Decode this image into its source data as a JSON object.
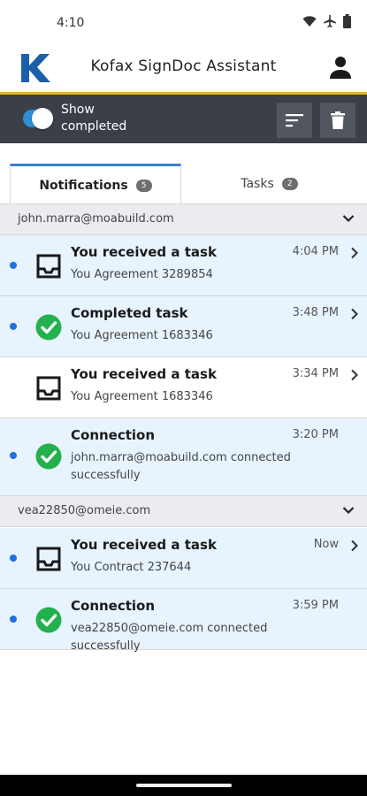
{
  "status_bar": {
    "time": "4:10"
  },
  "header": {
    "title": "Kofax SignDoc Assistant",
    "logo_letter": "K"
  },
  "toolbar": {
    "toggle_label": "Show completed",
    "toggle_on": true
  },
  "tabs": [
    {
      "label": "Notifications",
      "count": "5",
      "active": true
    },
    {
      "label": "Tasks",
      "count": "2",
      "active": false
    }
  ],
  "groups": [
    {
      "email": "john.marra@moabuild.com",
      "items": [
        {
          "title": "You received a task",
          "subtitle": "You Agreement 3289854",
          "time": "4:04 PM",
          "icon": "inbox-icon",
          "unread": true,
          "chevron": true
        },
        {
          "title": "Completed task",
          "subtitle": "You Agreement 1683346",
          "time": "3:48 PM",
          "icon": "check-circle-icon",
          "unread": true,
          "chevron": true
        },
        {
          "title": "You received a task",
          "subtitle": "You Agreement 1683346",
          "time": "3:34 PM",
          "icon": "inbox-icon",
          "unread": false,
          "chevron": true
        },
        {
          "title": "Connection",
          "subtitle": "john.marra@moabuild.com connected successfully",
          "time": "3:20 PM",
          "icon": "check-circle-icon",
          "unread": true,
          "chevron": false
        }
      ]
    },
    {
      "email": "vea22850@omeie.com",
      "items": [
        {
          "title": "You received a task",
          "subtitle": "You Contract 237644",
          "time": "Now",
          "icon": "inbox-icon",
          "unread": true,
          "chevron": true
        },
        {
          "title": "Connection",
          "subtitle": "vea22850@omeie.com connected successfully",
          "time": "3:59 PM",
          "icon": "check-circle-icon",
          "unread": true,
          "chevron": false
        }
      ]
    }
  ],
  "colors": {
    "accent": "#2f8fd8",
    "toolbar": "#3b3f47",
    "gold": "#e2b23a",
    "unread_bg": "#e7f3fd",
    "unread_dot": "#1f6fe0",
    "success": "#22b14c",
    "logo": "#1b5fa8"
  }
}
